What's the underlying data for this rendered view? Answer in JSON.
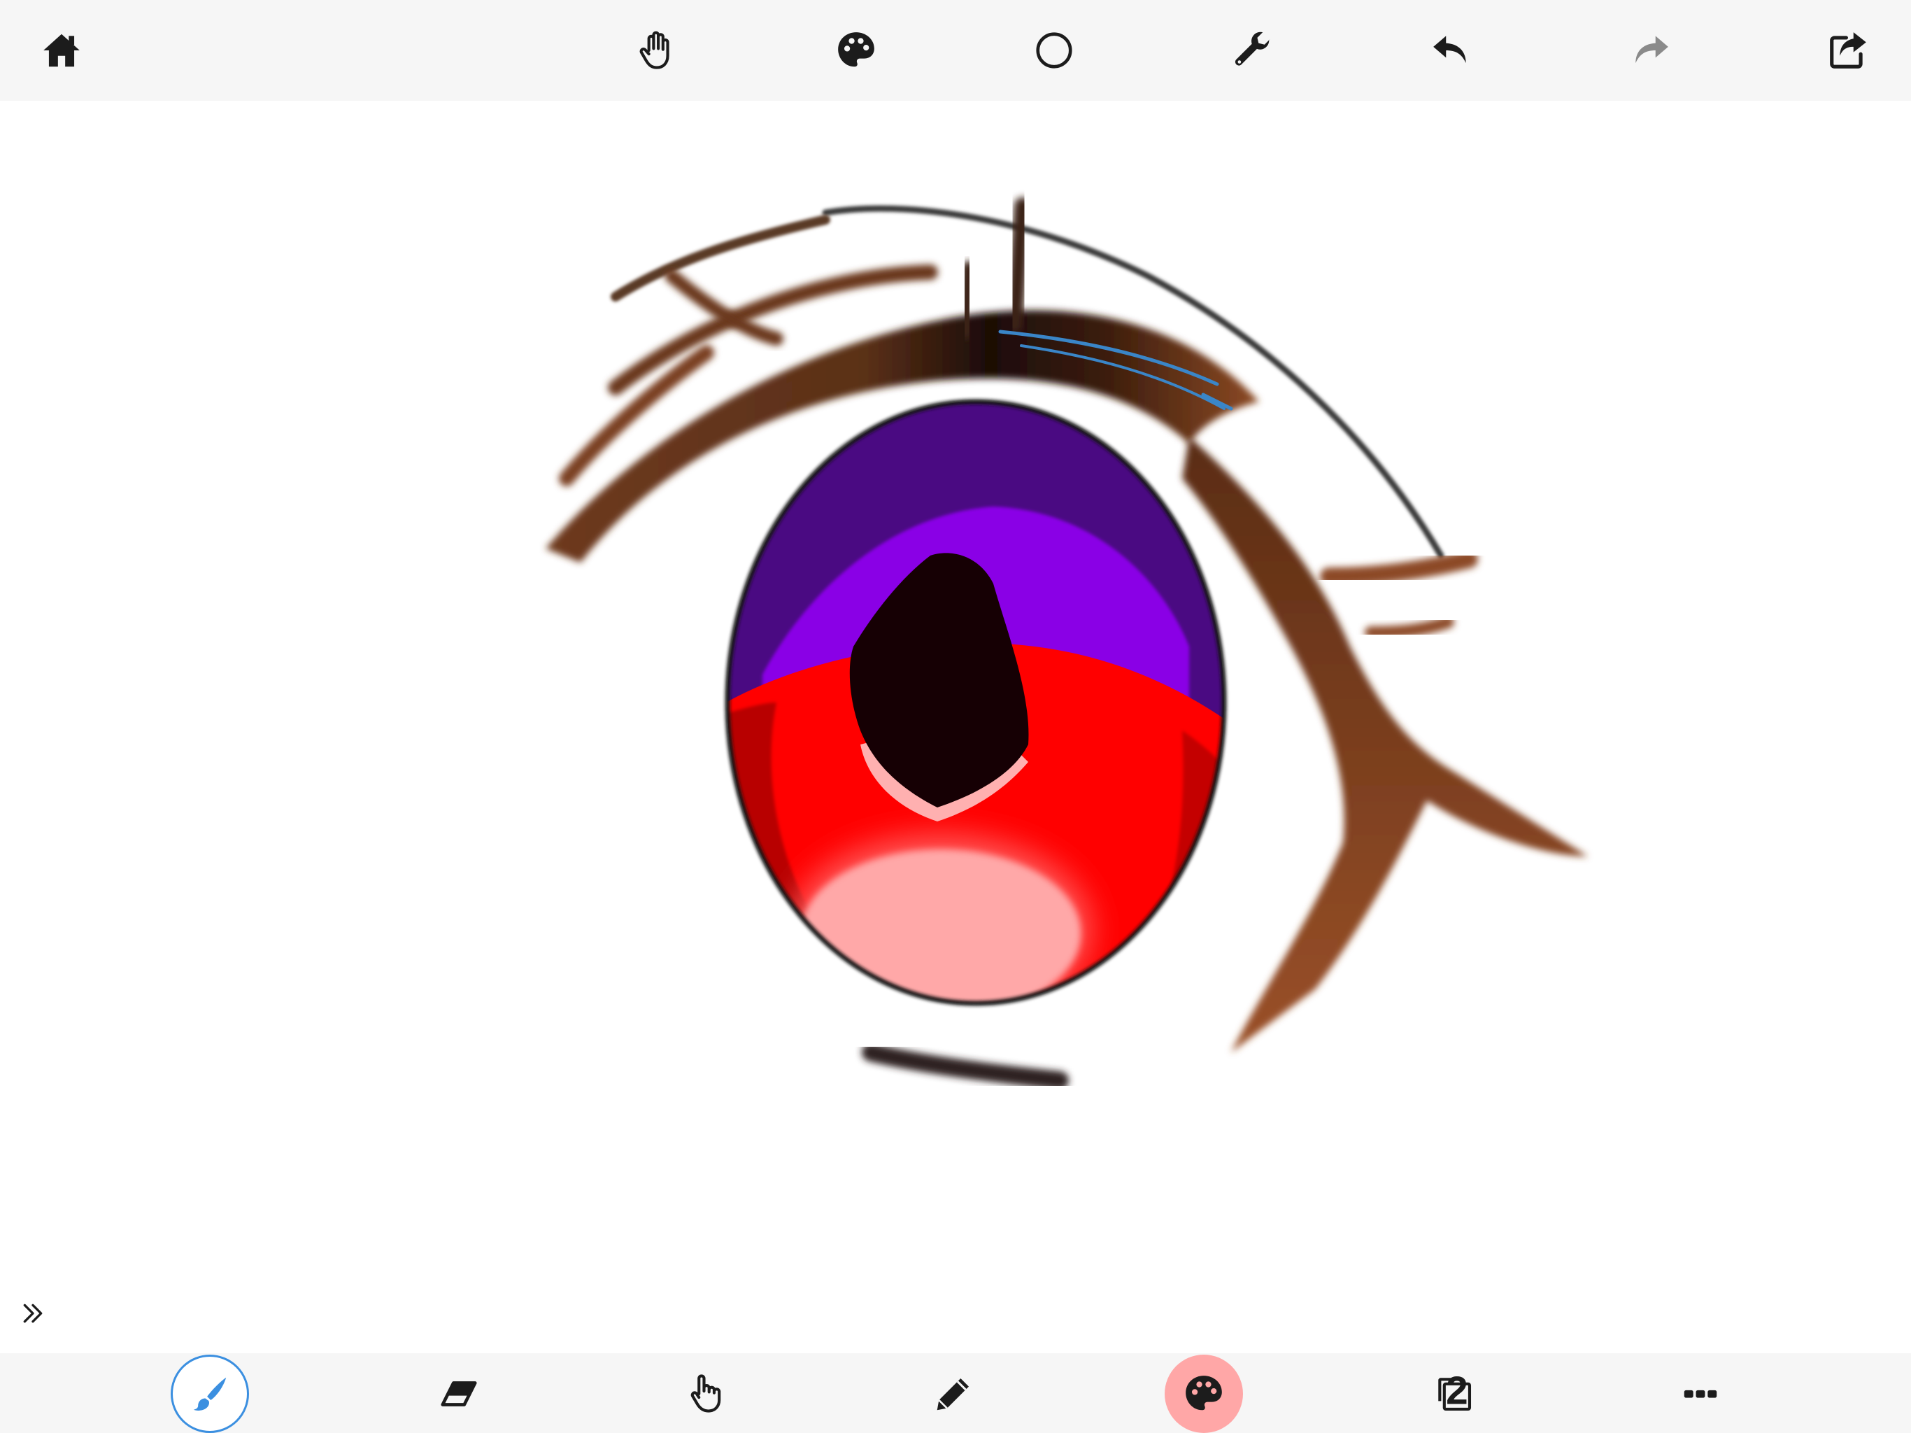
{
  "colors": {
    "toolbar_bg": "#f6f6f6",
    "icon": "#1c1c1c",
    "icon_disabled": "#8a8a8a",
    "active_brush_ring": "#3b8fe0",
    "active_brush_icon": "#3b8fe0",
    "current_color": "#ffa7a7"
  },
  "top_toolbar": {
    "home": {
      "icon": "home-icon"
    },
    "pan": {
      "icon": "hand-icon"
    },
    "palette": {
      "icon": "palette-icon"
    },
    "shape": {
      "icon": "circle-icon"
    },
    "settings": {
      "icon": "wrench-icon"
    },
    "undo": {
      "icon": "undo-icon"
    },
    "redo": {
      "icon": "redo-icon",
      "enabled": false
    },
    "share": {
      "icon": "share-icon"
    }
  },
  "canvas": {
    "description_icons": "anime-eye-drawing"
  },
  "bottom_toolbar": {
    "brush": {
      "icon": "brush-icon",
      "selected": true
    },
    "eraser": {
      "icon": "eraser-icon"
    },
    "finger": {
      "icon": "finger-icon"
    },
    "pencil": {
      "icon": "pencil-icon"
    },
    "color": {
      "icon": "palette-icon",
      "selected_color": "#ffa7a7"
    },
    "layers": {
      "icon": "layers-icon",
      "count": "2"
    },
    "more": {
      "icon": "more-icon"
    }
  },
  "expand": {
    "icon": "double-chevron-right-icon"
  }
}
